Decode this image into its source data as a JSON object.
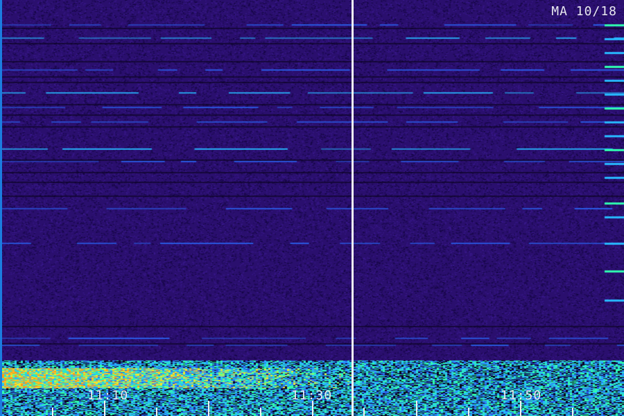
{
  "station_label": "MA 10/18",
  "time_labels": [
    "11:10",
    "11:30",
    "11:50"
  ],
  "colors": {
    "background": "#2a0f6e",
    "noise_dark": "#140640",
    "noise_light": "#3b1a8f",
    "line_blue": "#2a5ce8",
    "line_cyan": "#27b8ff",
    "line_green": "#2fffb0",
    "hot_yellow": "#f5e62a",
    "hot_orange": "#ff9a1a",
    "annotation": "#f2f2f2"
  }
}
